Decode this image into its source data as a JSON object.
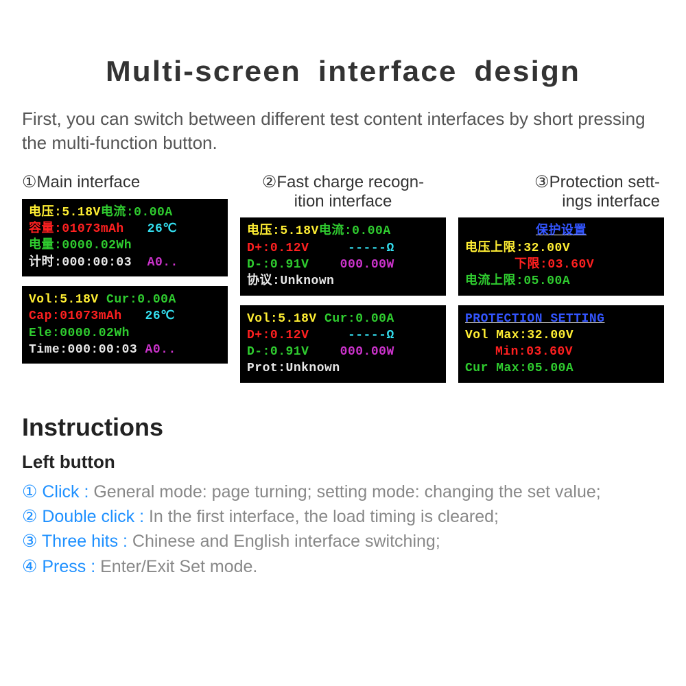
{
  "title": "Multi-screen  interface  design",
  "intro": "First, you can switch between different test content interfaces by short pressing the multi-function button.",
  "columns": {
    "c1_label": "①Main interface",
    "c2_label": "②Fast charge recogn-\n           ition interface",
    "c3_label": "③Protection sett-\nings interface"
  },
  "screens": {
    "s1a": {
      "r1_l": "电压:",
      "r1_lv": "5.18V",
      "r1_r": "电流:",
      "r1_rv": "0.00A",
      "r2_l": "容量:",
      "r2_v": "01073mAh",
      "r2_t": "26℃",
      "r3_l": "电量:",
      "r3_v": "0000.02Wh",
      "r4_l": "计时:",
      "r4_v": "000:00:03",
      "r4_s": "A0.."
    },
    "s1b": {
      "r1_l": "Vol:",
      "r1_lv": "5.18V",
      "r1_r": " Cur:",
      "r1_rv": "0.00A",
      "r2_l": "Cap:",
      "r2_v": "01073mAh",
      "r2_t": "26℃",
      "r3_l": "Ele:",
      "r3_v": "0000.02Wh",
      "r4_l": "Time:",
      "r4_v": "000:00:03",
      "r4_s": "A0.."
    },
    "s2a": {
      "r1_l": "电压:",
      "r1_lv": "5.18V",
      "r1_r": "电流:",
      "r1_rv": "0.00A",
      "r2_l": "D+:",
      "r2_v": "0.12V",
      "r2_o": "-----Ω",
      "r3_l": "D-:",
      "r3_v": "0.91V",
      "r3_w": "000.00W",
      "r4_l": "协议:",
      "r4_v": "Unknown"
    },
    "s2b": {
      "r1_l": "Vol:",
      "r1_lv": "5.18V",
      "r1_r": "Cur:",
      "r1_rv": "0.00A",
      "r2_l": "D+:",
      "r2_v": "0.12V",
      "r2_o": "-----Ω",
      "r3_l": "D-:",
      "r3_v": "0.91V",
      "r3_w": "000.00W",
      "r4_l": "Prot:",
      "r4_v": "Unknown"
    },
    "s3a": {
      "hdr": "保护设置",
      "r2_l": "电压上限:",
      "r2_v": "32.00V",
      "r3_l": "下限:",
      "r3_v": "03.60V",
      "r4_l": "电流上限:",
      "r4_v": "05.00A"
    },
    "s3b": {
      "hdr": "PROTECTION SETTING",
      "r2_l": "Vol Max:",
      "r2_v": "32.00V",
      "r3_l": "Min:",
      "r3_v": "03.60V",
      "r4_l": "Cur Max:",
      "r4_v": "05.00A"
    }
  },
  "instructions": {
    "heading": "Instructions",
    "subhead": "Left button",
    "b1_label": "① Click : ",
    "b1_text": "General mode: page turning; setting mode: changing the set value;",
    "b2_label": "② Double click : ",
    "b2_text": "In the first interface, the load timing is cleared;",
    "b3_label": "③ Three hits : ",
    "b3_text": "Chinese and English interface switching;",
    "b4_label": "④ Press : ",
    "b4_text": "Enter/Exit Set mode."
  }
}
